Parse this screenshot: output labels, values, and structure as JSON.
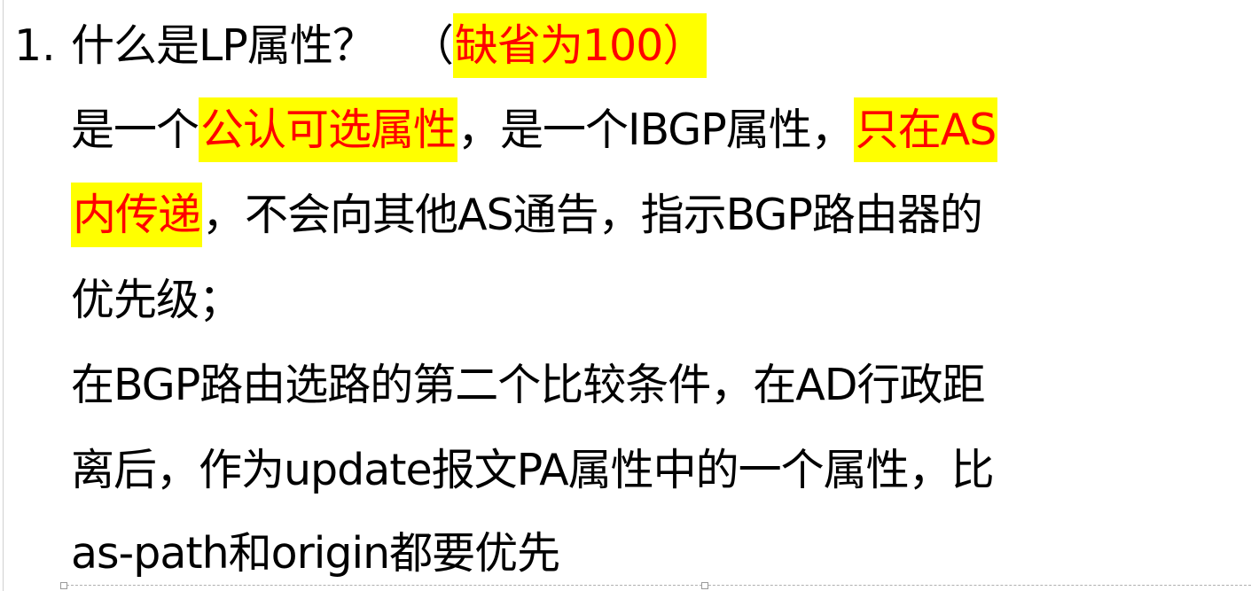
{
  "item": {
    "number": "1.",
    "question": "什么是LP属性？",
    "paren_open": "（",
    "default_note": "缺省为100",
    "paren_close": "）"
  },
  "lines": {
    "l2_a": "是一个",
    "l2_b_hl": "公认可选属性",
    "l2_c": "，是一个IBGP属性，",
    "l2_d_hl": "只在AS",
    "l3_a_hl": "内传递",
    "l3_b": "，不会向其他AS通告，指示BGP路由器的",
    "l4": "优先级；",
    "l5": "在BGP路由选路的第二个比较条件，在AD行政距",
    "l6": "离后，作为update报文PA属性中的一个属性，比",
    "l7": "as-path和origin都要优先"
  },
  "colors": {
    "highlight": "#ffff00",
    "emphasis_text": "#ff0000",
    "body_text": "#000000"
  }
}
